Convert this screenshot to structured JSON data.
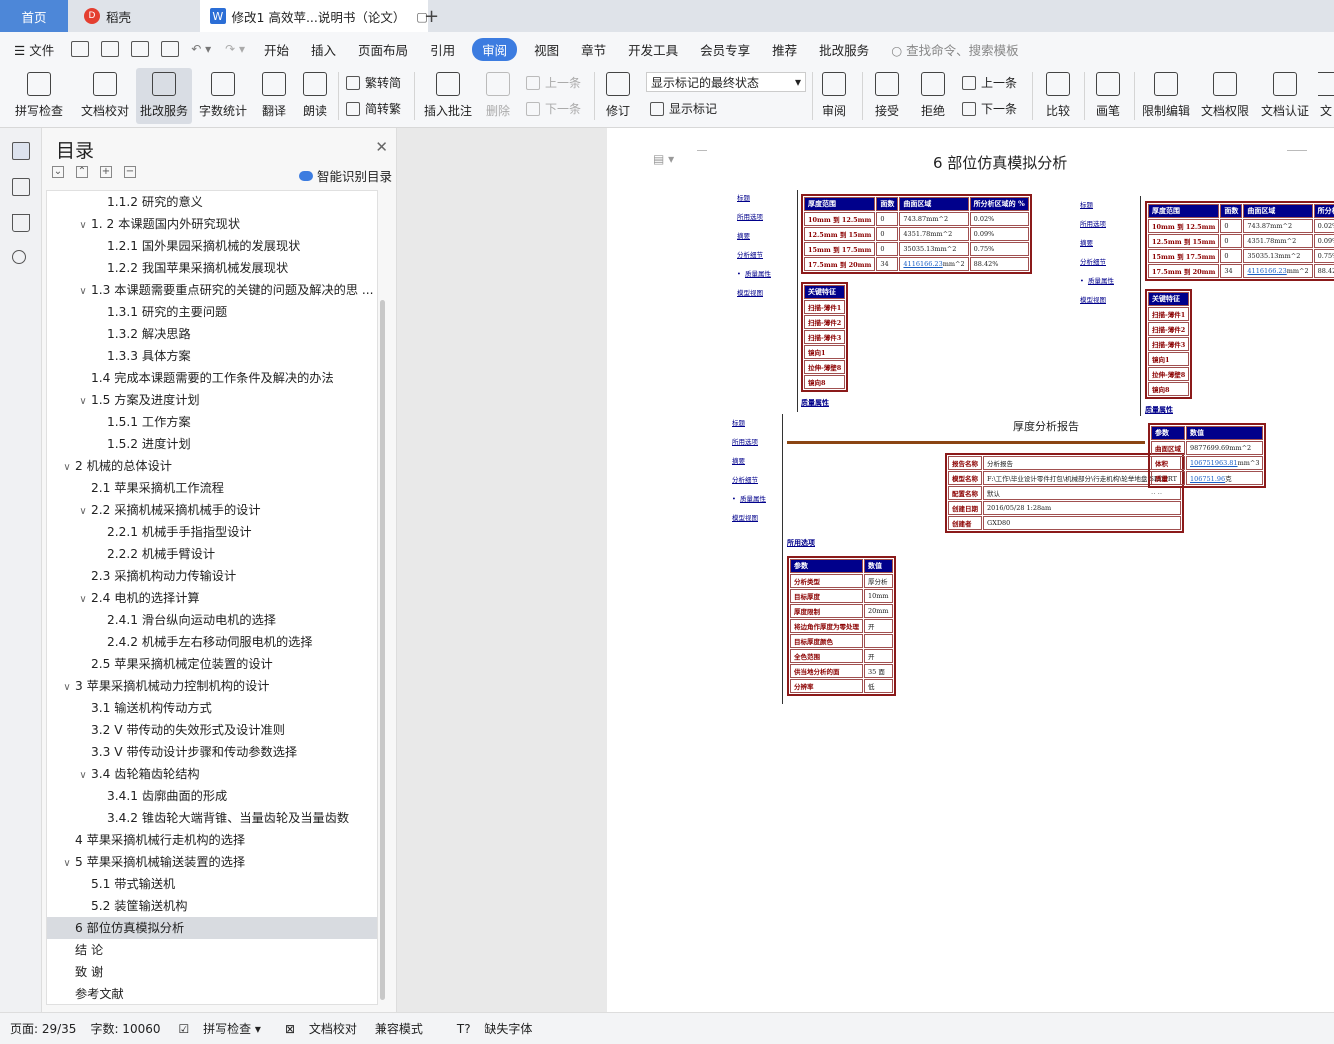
{
  "tabs": {
    "home": "首页",
    "daoke": "稻壳",
    "doc": "修改1 高效苹...说明书（论文）"
  },
  "menu": {
    "file": "文件",
    "items": [
      "开始",
      "插入",
      "页面布局",
      "引用",
      "审阅",
      "视图",
      "章节",
      "开发工具",
      "会员专享",
      "推荐",
      "批改服务"
    ],
    "active": "审阅",
    "search": "查找命令、搜索模板"
  },
  "ribbon": {
    "spell": "拼写检查",
    "proof": "文档校对",
    "correct": "批改服务",
    "wordcount": "字数统计",
    "translate": "翻译",
    "read": "朗读",
    "t2s": "繁转简",
    "s2t": "简转繁",
    "insert_comment": "插入批注",
    "delete": "删除",
    "prev": "上一条",
    "next": "下一条",
    "revise": "修订",
    "markup_state": "显示标记的最终状态",
    "show_markup": "显示标记",
    "review": "审阅",
    "accept": "接受",
    "reject": "拒绝",
    "prev2": "上一条",
    "next2": "下一条",
    "compare": "比较",
    "pen": "画笔",
    "restrict": "限制编辑",
    "rights": "文档权限",
    "certify": "文档认证",
    "more": "文"
  },
  "toc": {
    "title": "目录",
    "smart": "智能识别目录",
    "items": [
      {
        "t": "1.1.2 研究的意义",
        "l": 2,
        "a": ""
      },
      {
        "t": "1. 2 本课题国内外研究现状",
        "l": 1,
        "a": "v"
      },
      {
        "t": "1.2.1 国外果园采摘机械的发展现状",
        "l": 2,
        "a": ""
      },
      {
        "t": "1.2.2 我国苹果采摘机械发展现状",
        "l": 2,
        "a": ""
      },
      {
        "t": "1.3 本课题需要重点研究的关键的问题及解决的思 ...",
        "l": 1,
        "a": "v"
      },
      {
        "t": "1.3.1  研究的主要问题",
        "l": 2,
        "a": ""
      },
      {
        "t": "1.3.2  解决思路",
        "l": 2,
        "a": ""
      },
      {
        "t": "1.3.3 具体方案",
        "l": 2,
        "a": ""
      },
      {
        "t": "1.4 完成本课题需要的工作条件及解决的办法",
        "l": 1,
        "a": ""
      },
      {
        "t": "1.5  方案及进度计划",
        "l": 1,
        "a": "v"
      },
      {
        "t": "1.5.1  工作方案",
        "l": 2,
        "a": ""
      },
      {
        "t": "1.5.2 进度计划",
        "l": 2,
        "a": ""
      },
      {
        "t": "2 机械的总体设计",
        "l": 0,
        "a": "v"
      },
      {
        "t": "2.1 苹果采摘机工作流程",
        "l": 1,
        "a": ""
      },
      {
        "t": "2.2 采摘机械采摘机械手的设计",
        "l": 1,
        "a": "v"
      },
      {
        "t": "2.2.1 机械手手指指型设计",
        "l": 2,
        "a": ""
      },
      {
        "t": "2.2.2 机械手臂设计",
        "l": 2,
        "a": ""
      },
      {
        "t": "2.3 采摘机构动力传输设计",
        "l": 1,
        "a": ""
      },
      {
        "t": "2.4 电机的选择计算",
        "l": 1,
        "a": "v"
      },
      {
        "t": "2.4.1 滑台纵向运动电机的选择",
        "l": 2,
        "a": ""
      },
      {
        "t": "2.4.2 机械手左右移动伺服电机的选择",
        "l": 2,
        "a": ""
      },
      {
        "t": "2.5 苹果采摘机械定位装置的设计",
        "l": 1,
        "a": ""
      },
      {
        "t": "3 苹果采摘机械动力控制机构的设计",
        "l": 0,
        "a": "v"
      },
      {
        "t": "3.1 输送机构传动方式",
        "l": 1,
        "a": ""
      },
      {
        "t": "3.2 V 带传动的失效形式及设计准则",
        "l": 1,
        "a": ""
      },
      {
        "t": "3.3 V 带传动设计步骤和传动参数选择",
        "l": 1,
        "a": ""
      },
      {
        "t": "3.4 齿轮箱齿轮结构",
        "l": 1,
        "a": "v"
      },
      {
        "t": "3.4.1 齿廓曲面的形成",
        "l": 2,
        "a": ""
      },
      {
        "t": "3.4.2 锥齿轮大端背锥、当量齿轮及当量齿数",
        "l": 2,
        "a": ""
      },
      {
        "t": "4 苹果采摘机械行走机构的选择",
        "l": 0,
        "a": ""
      },
      {
        "t": "5 苹果采摘机械输送装置的选择",
        "l": 0,
        "a": "v"
      },
      {
        "t": "5.1 带式输送机",
        "l": 1,
        "a": ""
      },
      {
        "t": "5.2  装筐输送机构",
        "l": 1,
        "a": ""
      },
      {
        "t": "6 部位仿真模拟分析",
        "l": 0,
        "a": "",
        "cur": true
      },
      {
        "t": "结    论",
        "l": 0,
        "a": ""
      },
      {
        "t": "致    谢",
        "l": 0,
        "a": ""
      },
      {
        "t": "参考文献",
        "l": 0,
        "a": ""
      }
    ]
  },
  "doc": {
    "title": "6 部位仿真模拟分析",
    "nav": [
      "标题",
      "所用选项",
      "摘要",
      "分析细节",
      "质量属性",
      "模型视图"
    ],
    "thick_headers": [
      "厚度范围",
      "面数",
      "曲面区域",
      "所分析区域的 %"
    ],
    "thick_rows": [
      [
        "10mm 到 12.5mm",
        "0",
        "743.87mm^2",
        "0.02%"
      ],
      [
        "12.5mm 到 15mm",
        "0",
        "4351.78mm^2",
        "0.09%"
      ],
      [
        "15mm 到 17.5mm",
        "0",
        "35035.13mm^2",
        "0.75%"
      ],
      [
        "17.5mm 到 20mm",
        "34",
        "4116166.23",
        "mm^2",
        "88.42%"
      ]
    ],
    "key_header": "关键特征",
    "key_rows": [
      "扫描-薄件1",
      "扫描-薄件2",
      "扫描-薄件3",
      "镜向1",
      "拉伸-薄壁8",
      "镜向8"
    ],
    "quality": "质量属性",
    "report_title": "厚度分析报告",
    "info_rows": [
      [
        "报告名称",
        "分析报告"
      ],
      [
        "模型名称",
        "F:\\工作\\毕业设计零件打包\\机械部分\\行走机构\\轮举地盘.SLDPRT"
      ],
      [
        "配置名称",
        "默认"
      ],
      [
        "创建日期",
        "2016/05/28 1:28am"
      ],
      [
        "创建者",
        "GXD80"
      ]
    ],
    "prop_headers": [
      "参数",
      "数值"
    ],
    "prop_rows": [
      [
        "曲面区域",
        "9877699.69mm^2",
        ""
      ],
      [
        "体积",
        "106751963.81",
        "mm^3"
      ],
      [
        "质量",
        "106751.96",
        "克"
      ]
    ],
    "dots": "..  ..",
    "opts_label": "所用选项",
    "opt_headers": [
      "参数",
      "数值"
    ],
    "opt_rows": [
      [
        "分析类型",
        "厚分析"
      ],
      [
        "目标厚度",
        "10mm"
      ],
      [
        "厚度限制",
        "20mm"
      ],
      [
        "将边角作厚度为零处理",
        "开"
      ],
      [
        "目标厚度颜色",
        ""
      ],
      [
        "全色范围",
        "开"
      ],
      [
        "供当地分析的面",
        "35 面"
      ],
      [
        "分辨率",
        "低"
      ]
    ]
  },
  "status": {
    "page": "页面: 29/35",
    "words": "字数: 10060",
    "spell": "拼写检查",
    "proof": "文档校对",
    "compat": "兼容模式",
    "font": "缺失字体"
  }
}
